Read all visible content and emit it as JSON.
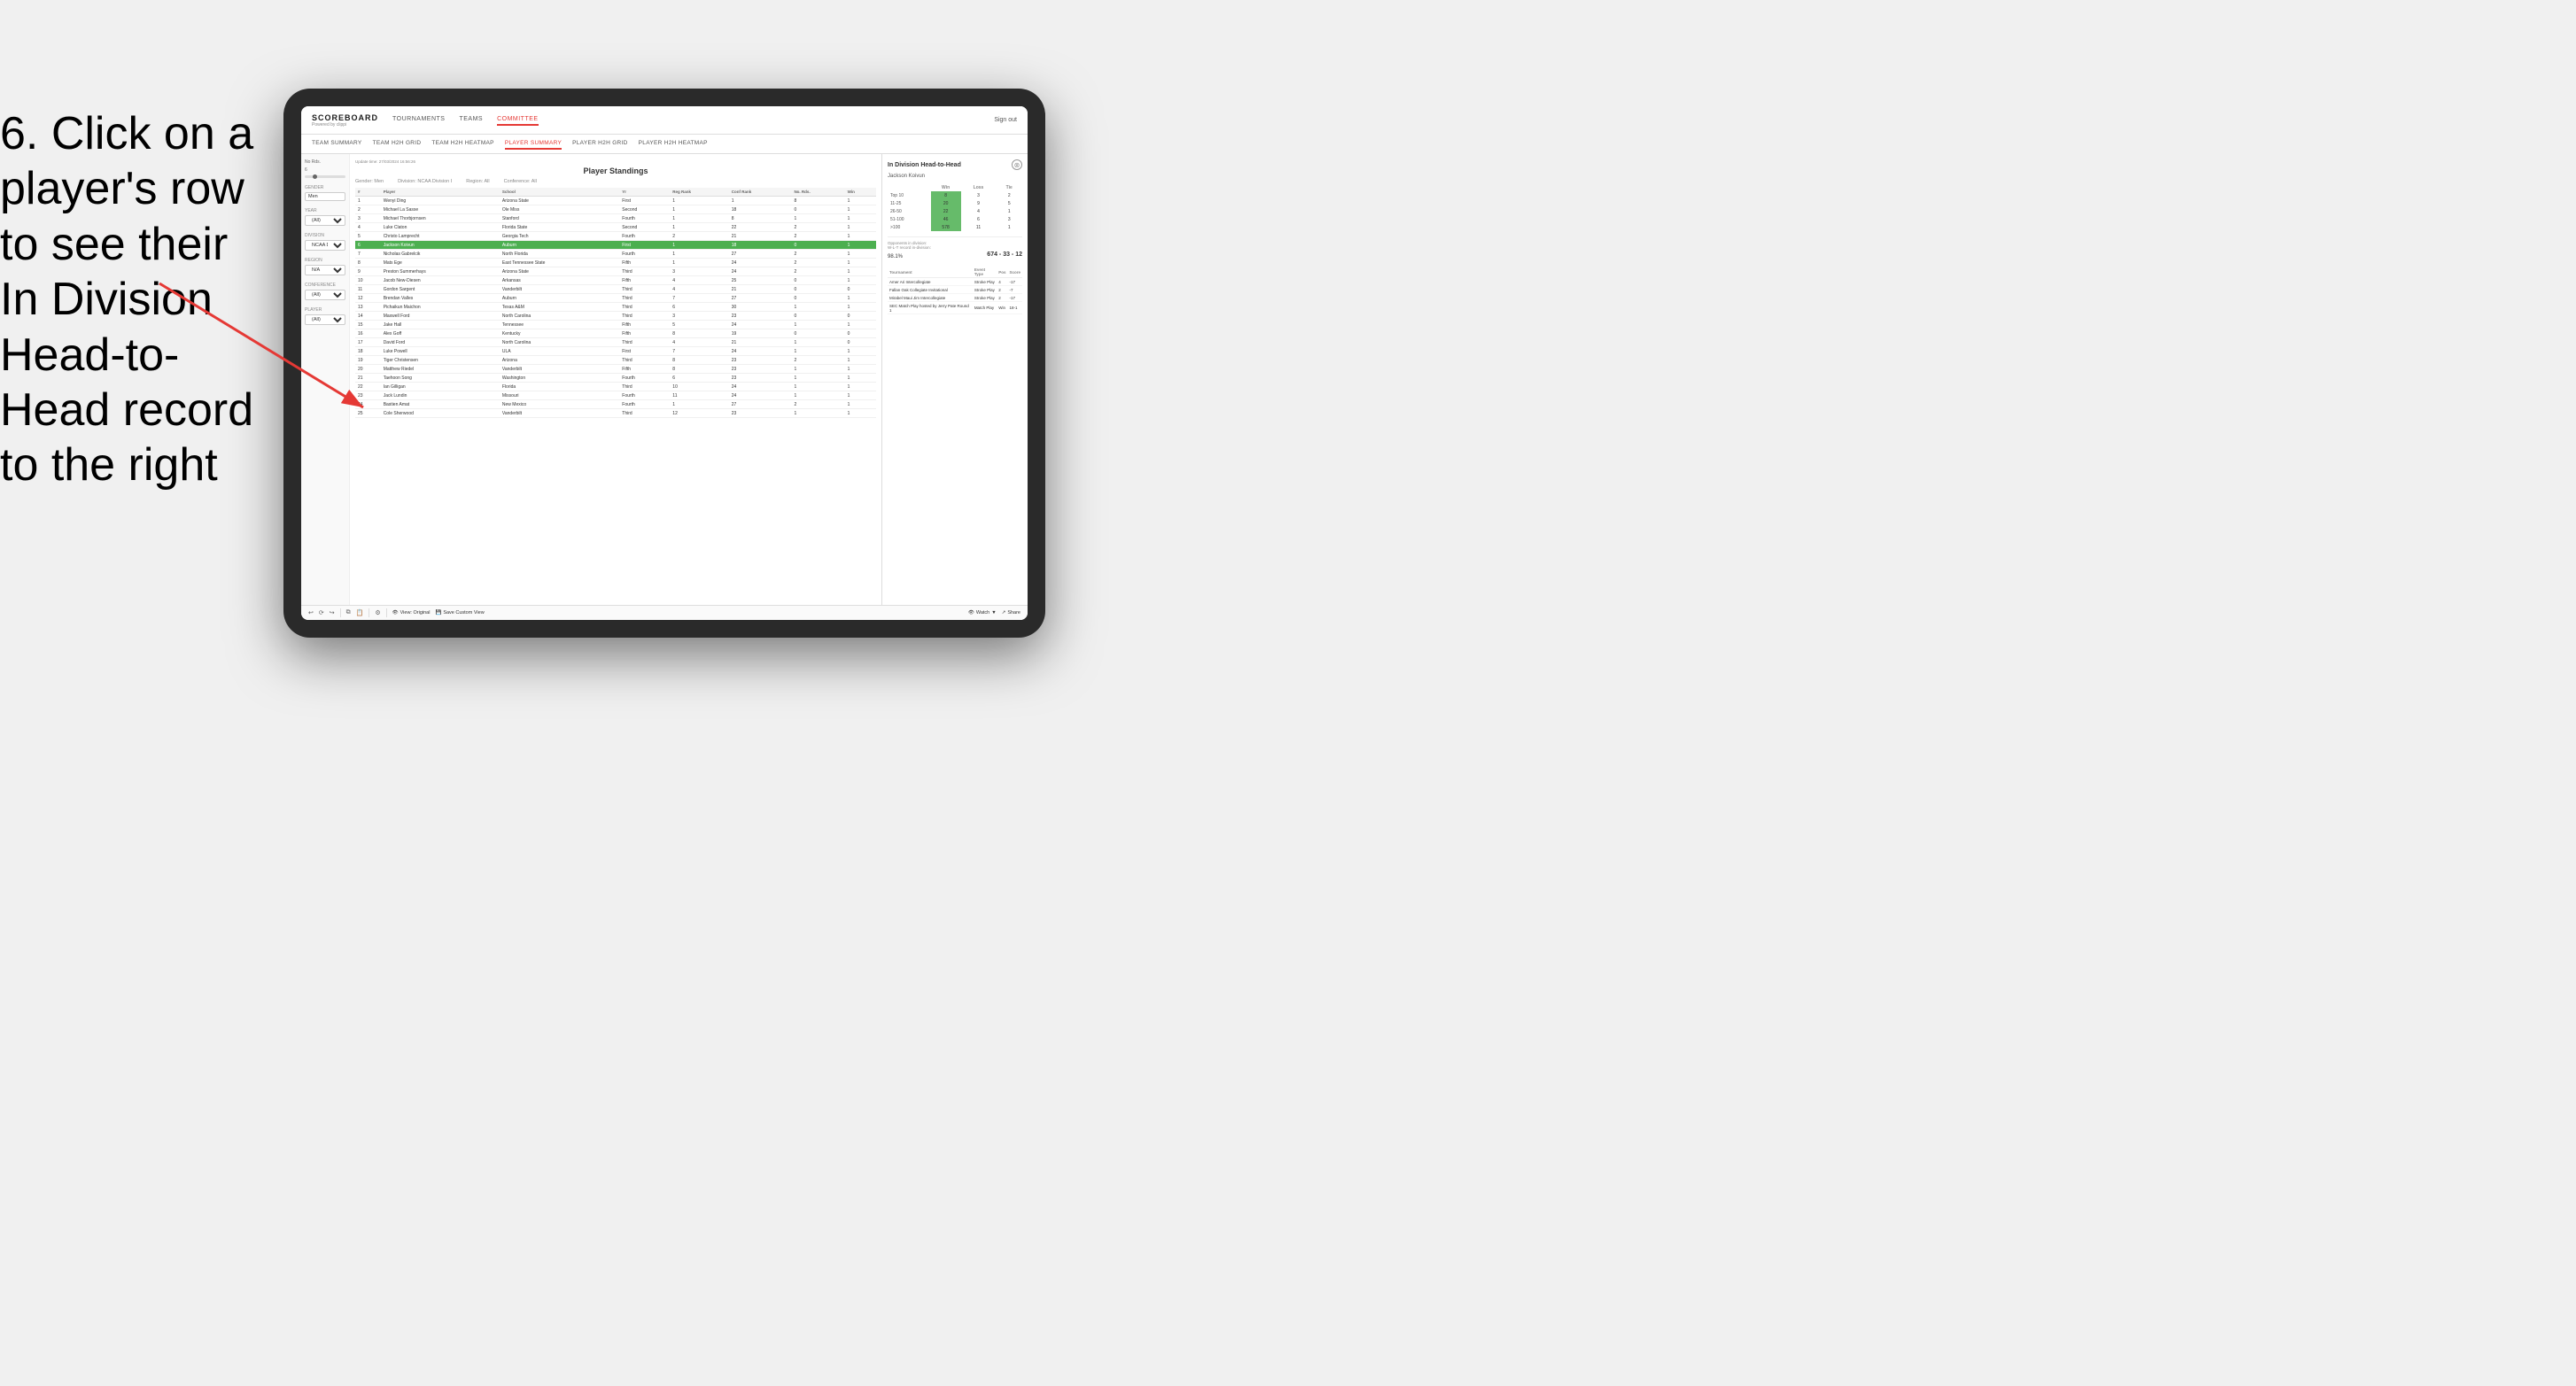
{
  "instruction": {
    "text": "6. Click on a player's row to see their In Division Head-to-Head record to the right"
  },
  "header": {
    "logo": "SCOREBOARD",
    "logo_sub": "Powered by clippi",
    "nav": [
      "TOURNAMENTS",
      "TEAMS",
      "COMMITTEE"
    ],
    "sign_out": "Sign out"
  },
  "sub_nav": {
    "items": [
      "TEAM SUMMARY",
      "TEAM H2H GRID",
      "TEAM H2H HEATMAP",
      "PLAYER SUMMARY",
      "PLAYER H2H GRID",
      "PLAYER H2H HEATMAP"
    ],
    "active": "PLAYER SUMMARY"
  },
  "sidebar": {
    "no_rds_label": "No Rds.",
    "no_rds_value": "6",
    "gender_label": "Gender",
    "gender_value": "Men",
    "year_label": "Year",
    "year_value": "(All)",
    "division_label": "Division",
    "division_value": "NCAA Division I",
    "region_label": "Region",
    "region_value": "N/A",
    "conference_label": "Conference",
    "conference_value": "(All)",
    "player_label": "Player",
    "player_value": "(All)"
  },
  "standings": {
    "update_time": "Update time: 27/03/2024 16:56:26",
    "title": "Player Standings",
    "gender": "Men",
    "division": "NCAA Division I",
    "region": "All",
    "conference": "All",
    "columns": [
      "#",
      "Player",
      "School",
      "Yr",
      "Reg Rank",
      "Conf Rank",
      "No. Rds.",
      "Win"
    ],
    "rows": [
      {
        "rank": 1,
        "player": "Wenyi Ding",
        "school": "Arizona State",
        "yr": "First",
        "reg": 1,
        "conf": 1,
        "rds": 8,
        "win": 1
      },
      {
        "rank": 2,
        "player": "Michael La Sasse",
        "school": "Ole Miss",
        "yr": "Second",
        "reg": 1,
        "conf": 18,
        "rds": 0,
        "win": 1
      },
      {
        "rank": 3,
        "player": "Michael Thorbjornsen",
        "school": "Stanford",
        "yr": "Fourth",
        "reg": 1,
        "conf": 8,
        "rds": 1,
        "win": 1
      },
      {
        "rank": 4,
        "player": "Luke Claton",
        "school": "Florida State",
        "yr": "Second",
        "reg": 1,
        "conf": 22,
        "rds": 2,
        "win": 1
      },
      {
        "rank": 5,
        "player": "Christo Lamprecht",
        "school": "Georgia Tech",
        "yr": "Fourth",
        "reg": 2,
        "conf": 21,
        "rds": 2,
        "win": 1
      },
      {
        "rank": 6,
        "player": "Jackson Koivun",
        "school": "Auburn",
        "yr": "First",
        "reg": 1,
        "conf": 18,
        "rds": 0,
        "win": 1,
        "highlighted": true
      },
      {
        "rank": 7,
        "player": "Nicholas Gabrelcik",
        "school": "North Florida",
        "yr": "Fourth",
        "reg": 1,
        "conf": 27,
        "rds": 2,
        "win": 1
      },
      {
        "rank": 8,
        "player": "Mats Ege",
        "school": "East Tennessee State",
        "yr": "Fifth",
        "reg": 1,
        "conf": 24,
        "rds": 2,
        "win": 1
      },
      {
        "rank": 9,
        "player": "Preston Summerhays",
        "school": "Arizona State",
        "yr": "Third",
        "reg": 3,
        "conf": 24,
        "rds": 2,
        "win": 1
      },
      {
        "rank": 10,
        "player": "Jacob New-Diesen",
        "school": "Arkansas",
        "yr": "Fifth",
        "reg": 4,
        "conf": 25,
        "rds": 0,
        "win": 1
      },
      {
        "rank": 11,
        "player": "Gordon Sargent",
        "school": "Vanderbilt",
        "yr": "Third",
        "reg": 4,
        "conf": 21,
        "rds": 0,
        "win": 0
      },
      {
        "rank": 12,
        "player": "Brendan Valles",
        "school": "Auburn",
        "yr": "Third",
        "reg": 7,
        "conf": 27,
        "rds": 0,
        "win": 1
      },
      {
        "rank": 13,
        "player": "Pichaikun Maichon",
        "school": "Texas A&M",
        "yr": "Third",
        "reg": 6,
        "conf": 30,
        "rds": 1,
        "win": 1
      },
      {
        "rank": 14,
        "player": "Maxwell Ford",
        "school": "North Carolina",
        "yr": "Third",
        "reg": 3,
        "conf": 23,
        "rds": 0,
        "win": 0
      },
      {
        "rank": 15,
        "player": "Jake Hall",
        "school": "Tennessee",
        "yr": "Fifth",
        "reg": 5,
        "conf": 24,
        "rds": 1,
        "win": 1
      },
      {
        "rank": 16,
        "player": "Alex Goff",
        "school": "Kentucky",
        "yr": "Fifth",
        "reg": 8,
        "conf": 19,
        "rds": 0,
        "win": 0
      },
      {
        "rank": 17,
        "player": "David Ford",
        "school": "North Carolina",
        "yr": "Third",
        "reg": 4,
        "conf": 21,
        "rds": 1,
        "win": 0
      },
      {
        "rank": 18,
        "player": "Luke Powell",
        "school": "ULA",
        "yr": "First",
        "reg": 7,
        "conf": 24,
        "rds": 1,
        "win": 1
      },
      {
        "rank": 19,
        "player": "Tiger Christensen",
        "school": "Arizona",
        "yr": "Third",
        "reg": 8,
        "conf": 23,
        "rds": 2,
        "win": 1
      },
      {
        "rank": 20,
        "player": "Matthew Riedel",
        "school": "Vanderbilt",
        "yr": "Fifth",
        "reg": 8,
        "conf": 23,
        "rds": 1,
        "win": 1
      },
      {
        "rank": 21,
        "player": "Taehoon Song",
        "school": "Washington",
        "yr": "Fourth",
        "reg": 6,
        "conf": 23,
        "rds": 1,
        "win": 1
      },
      {
        "rank": 22,
        "player": "Ian Gilligan",
        "school": "Florida",
        "yr": "Third",
        "reg": 10,
        "conf": 24,
        "rds": 1,
        "win": 1
      },
      {
        "rank": 23,
        "player": "Jack Lundin",
        "school": "Missouri",
        "yr": "Fourth",
        "reg": 11,
        "conf": 24,
        "rds": 1,
        "win": 1
      },
      {
        "rank": 24,
        "player": "Bastien Amat",
        "school": "New Mexico",
        "yr": "Fourth",
        "reg": 1,
        "conf": 27,
        "rds": 2,
        "win": 1
      },
      {
        "rank": 25,
        "player": "Cole Sherwood",
        "school": "Vanderbilt",
        "yr": "Third",
        "reg": 12,
        "conf": 23,
        "rds": 1,
        "win": 1
      }
    ]
  },
  "h2h_panel": {
    "title": "In Division Head-to-Head",
    "player_name": "Jackson Koivun",
    "columns": [
      "Win",
      "Loss",
      "Tie"
    ],
    "rows": [
      {
        "range": "Top 10",
        "win": 8,
        "loss": 3,
        "tie": 2
      },
      {
        "range": "11-25",
        "win": 20,
        "loss": 9,
        "tie": 5
      },
      {
        "range": "26-50",
        "win": 22,
        "loss": 4,
        "tie": 1
      },
      {
        "range": "51-100",
        "win": 46,
        "loss": 6,
        "tie": 3
      },
      {
        "range": ">100",
        "win": 578,
        "loss": 11,
        "tie": 1
      }
    ],
    "opponents_label": "Opponents in division:",
    "wl_label": "W-L-T record in-division:",
    "opponents_pct": "98.1%",
    "record": "674 - 33 - 12",
    "tournament_columns": [
      "Tournament",
      "Event Type",
      "Pos",
      "Score"
    ],
    "tournaments": [
      {
        "tournament": "Amer Ari Intercollegiate",
        "type": "Stroke Play",
        "pos": 4,
        "score": "-17"
      },
      {
        "tournament": "Fallan Oak Collegiate Invitational",
        "type": "Stroke Play",
        "pos": 2,
        "score": "-7"
      },
      {
        "tournament": "Mirabel Maui Jim Intercollegiate",
        "type": "Stroke Play",
        "pos": 2,
        "score": "-17"
      },
      {
        "tournament": "SEC Match Play hosted by Jerry Pate Round 1",
        "type": "Match Play",
        "pos": "Win",
        "score": "18-1"
      }
    ]
  },
  "toolbar": {
    "view_original": "View: Original",
    "save_custom": "Save Custom View",
    "watch": "Watch",
    "share": "Share"
  }
}
